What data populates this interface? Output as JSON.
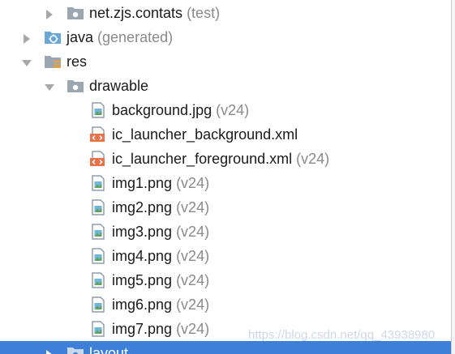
{
  "tree": {
    "rows": [
      {
        "name": "net.zjs.contats",
        "hint": " (test)"
      },
      {
        "name": "java",
        "hint": " (generated)"
      },
      {
        "name": "res",
        "hint": ""
      },
      {
        "name": "drawable",
        "hint": ""
      },
      {
        "name": "background.jpg",
        "hint": " (v24)"
      },
      {
        "name": "ic_launcher_background.xml",
        "hint": ""
      },
      {
        "name": "ic_launcher_foreground.xml",
        "hint": " (v24)"
      },
      {
        "name": "img1.png",
        "hint": " (v24)"
      },
      {
        "name": "img2.png",
        "hint": " (v24)"
      },
      {
        "name": "img3.png",
        "hint": " (v24)"
      },
      {
        "name": "img4.png",
        "hint": " (v24)"
      },
      {
        "name": "img5.png",
        "hint": " (v24)"
      },
      {
        "name": "img6.png",
        "hint": " (v24)"
      },
      {
        "name": "img7.png",
        "hint": " (v24)"
      },
      {
        "name": "layout",
        "hint": ""
      }
    ]
  },
  "watermark": "https://blog.csdn.net/qq_43938980",
  "colors": {
    "selection": "#3d7fd9",
    "folder_icon": "#8c9aa6",
    "xml_icon": "#e8734a",
    "image_icon": "#6aa0c8",
    "hint_text": "#8a8a8a"
  },
  "icons": {
    "collapsed": "chevron-right-icon",
    "expanded": "chevron-down-icon",
    "folder": "folder-icon",
    "generated_folder": "generated-folder-icon",
    "resource_folder": "resource-folder-icon",
    "image_file": "image-file-icon",
    "xml_file": "xml-file-icon"
  }
}
